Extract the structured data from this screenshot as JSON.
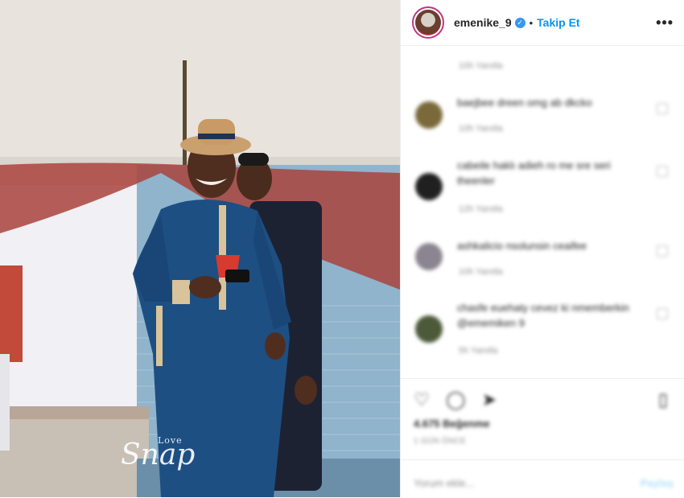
{
  "post": {
    "username": "emenike_9",
    "verified_icon": "verified-badge-icon",
    "dot": "•",
    "follow_label": "Takip Et",
    "more_label": "•••",
    "watermark_text": "Love",
    "watermark_script": "Snap"
  },
  "comments_meta_top": "10h  Yanıtla",
  "comments": [
    {
      "text": "baejbee dreen omg ab dkcko",
      "meta": "10h  Yanıtla",
      "avatar_color": "#7a6a3a"
    },
    {
      "text": "cabeile haklı adieh ro me sre seri theenler",
      "meta": "12h  Yanıtla",
      "avatar_color": "#202020"
    },
    {
      "text": "ashkalicio nsolunsin ceaifee",
      "meta": "10h  Yanıtla",
      "avatar_color": "#8a8590"
    },
    {
      "text": "chasfe euehaty cevez  ki nmemberkin @ememiken 9",
      "meta": "5h  Yanıtla",
      "avatar_color": "#4d5a3a"
    }
  ],
  "actions": {
    "likes_text": "4.675 Beğenme",
    "time_text": "1 GÜN ÖNCE",
    "comment_placeholder": "Yorum ekle...",
    "share_label": "Paylaş"
  },
  "colors": {
    "accent": "#0095f6",
    "wall": "#e7e2dc",
    "robe": "#1c4f82",
    "drape": "#a8403a"
  }
}
